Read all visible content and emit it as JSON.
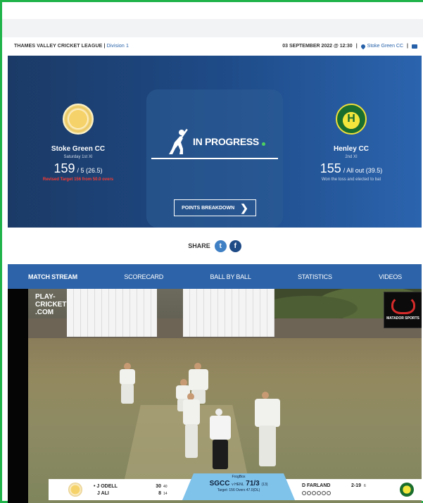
{
  "breadcrumb": {
    "league": "THAMES VALLEY CRICKET LEAGUE",
    "separator": "|",
    "division": "Division 1",
    "datetime": "03 SEPTEMBER 2022 @ 12:30",
    "venue": "Stoke Green CC"
  },
  "home": {
    "name": "Stoke Green CC",
    "team": "Saturday 1st XI",
    "runs": "159",
    "wickets_overs": "/ 5 (26.5)",
    "note": "Revised Target 156 from 50.0 overs"
  },
  "away": {
    "name": "Henley CC",
    "team": "2nd XI",
    "runs": "155",
    "wickets_overs": "/ All out (39.5)",
    "note": "Won the toss and elected to bat",
    "crest_letter": "H"
  },
  "status": {
    "label": "IN PROGRESS",
    "button": "POINTS BREAKDOWN"
  },
  "share": {
    "label": "SHARE",
    "twitter_glyph": "t",
    "facebook_glyph": "f"
  },
  "tabs": [
    "MATCH STREAM",
    "SCORECARD",
    "BALL BY BALL",
    "STATISTICS",
    "VIDEOS"
  ],
  "video": {
    "overlay_logo_line1": "PLAY-",
    "overlay_logo_line2": "CRICKET",
    "overlay_logo_line3": ".COM",
    "sponsor": "MATADOR SPORTS",
    "scorebar": {
      "bat1": "• J ODELL",
      "bat1_runs": "30",
      "bat1_balls": "40",
      "bat2": "J ALI",
      "bat2_runs": "8",
      "bat2_balls": "14",
      "brand": "FrogBox",
      "teams": "SGCC",
      "vs": "v HENL",
      "score": "71/3",
      "overs": "(13)",
      "target": "Target: 156 Overs 47.0(DL)",
      "bowler": "D FARLAND",
      "bowler_fig": "2-19",
      "bowler_overs": "6"
    }
  },
  "colors": {
    "hero_left": "#1b3a66",
    "hero_right": "#2b64ae",
    "tab_bar": "#2d63a8",
    "accent_link": "#2560a8",
    "alert_red": "#ff3b30",
    "frame_green": "#1fb34a"
  }
}
